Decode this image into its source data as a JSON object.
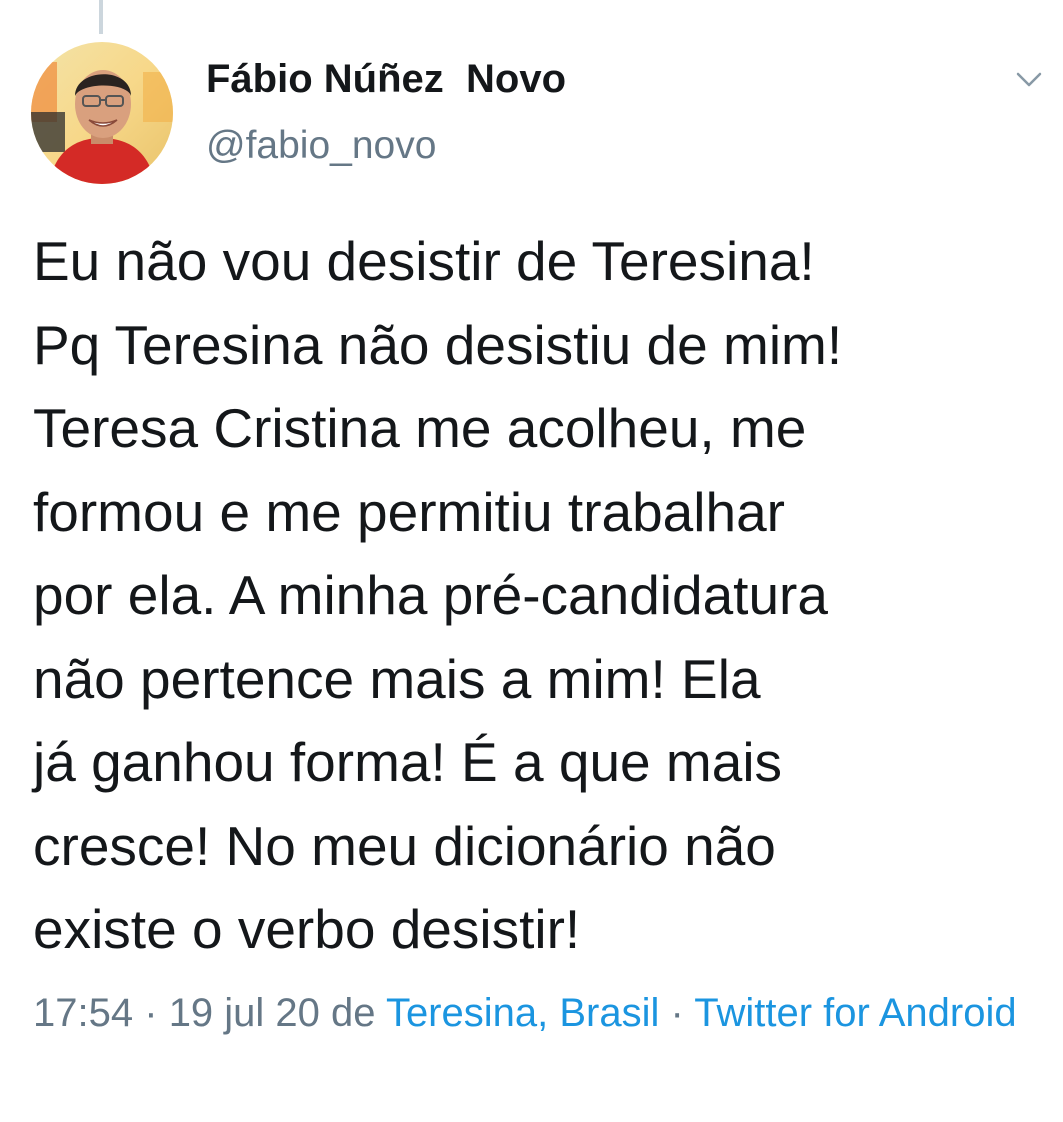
{
  "tweet": {
    "author": {
      "display_name": "Fábio Núñez  Novo",
      "handle": "@fabio_novo"
    },
    "menu_icon": "chevron-down-icon",
    "text": "Eu não vou desistir de Teresina!\nPq Teresina não desistiu de mim!\nTeresa Cristina me acolheu, me\nformou e me permitiu trabalhar\npor ela. A minha pré-candidatura\nnão pertence mais a mim! Ela\njá ganhou forma! É a que mais\ncresce! No meu dicionário não\nexiste o verbo desistir!",
    "meta": {
      "time": "17:54",
      "date": "19 jul 20",
      "sep": "·",
      "from_word": "de",
      "location": "Teresina, Brasil",
      "source": "Twitter for Android"
    }
  },
  "colors": {
    "text": "#14171a",
    "secondary": "#657786",
    "link": "#1b95e0",
    "thread_line": "#ccd6dd"
  }
}
